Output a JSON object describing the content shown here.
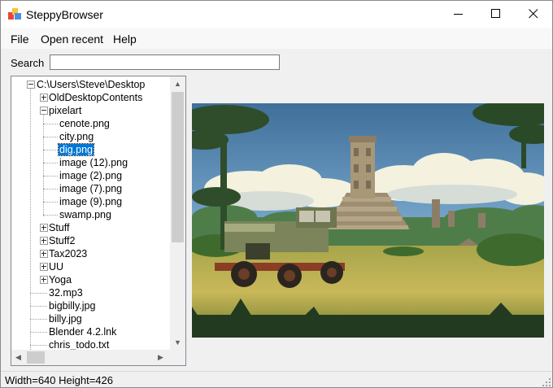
{
  "window": {
    "title": "SteppyBrowser",
    "icon": "app-icon",
    "controls": [
      "minimize-icon",
      "maximize-icon",
      "close-icon"
    ]
  },
  "menu": {
    "items": [
      "File",
      "Open recent",
      "Help"
    ]
  },
  "search": {
    "label": "Search",
    "value": "",
    "placeholder": ""
  },
  "tree": {
    "rows": [
      {
        "label": "C:\\Users\\Steve\\Desktop",
        "level": 0,
        "expander": "minus",
        "selected": false
      },
      {
        "label": "OldDesktopContents",
        "level": 1,
        "expander": "plus",
        "selected": false
      },
      {
        "label": "pixelart",
        "level": 1,
        "expander": "minus",
        "selected": false
      },
      {
        "label": "cenote.png",
        "level": 2,
        "expander": "none",
        "selected": false
      },
      {
        "label": "city.png",
        "level": 2,
        "expander": "none",
        "selected": false
      },
      {
        "label": "dig.png",
        "level": 2,
        "expander": "none",
        "selected": true
      },
      {
        "label": "image (12).png",
        "level": 2,
        "expander": "none",
        "selected": false
      },
      {
        "label": "image (2).png",
        "level": 2,
        "expander": "none",
        "selected": false
      },
      {
        "label": "image (7).png",
        "level": 2,
        "expander": "none",
        "selected": false
      },
      {
        "label": "image (9).png",
        "level": 2,
        "expander": "none",
        "selected": false
      },
      {
        "label": "swamp.png",
        "level": 2,
        "expander": "none",
        "selected": false
      },
      {
        "label": "Stuff",
        "level": 1,
        "expander": "plus",
        "selected": false
      },
      {
        "label": "Stuff2",
        "level": 1,
        "expander": "plus",
        "selected": false
      },
      {
        "label": "Tax2023",
        "level": 1,
        "expander": "plus",
        "selected": false
      },
      {
        "label": "UU",
        "level": 1,
        "expander": "plus",
        "selected": false
      },
      {
        "label": "Yoga",
        "level": 1,
        "expander": "plus",
        "selected": false
      },
      {
        "label": "32.mp3",
        "level": 1,
        "expander": "none",
        "selected": false
      },
      {
        "label": "bigbilly.jpg",
        "level": 1,
        "expander": "none",
        "selected": false
      },
      {
        "label": "billy.jpg",
        "level": 1,
        "expander": "none",
        "selected": false
      },
      {
        "label": "Blender 4.2.lnk",
        "level": 1,
        "expander": "none",
        "selected": false
      },
      {
        "label": "chris_todo.txt",
        "level": 1,
        "expander": "none",
        "selected": false
      }
    ]
  },
  "preview": {
    "image": "pixel-art-jeep-jungle-ruins"
  },
  "status": {
    "text": "Width=640 Height=426"
  },
  "colors": {
    "selection": "#0078d7",
    "window_bg": "#f0f0f0",
    "titlebar_bg": "#ffffff"
  }
}
